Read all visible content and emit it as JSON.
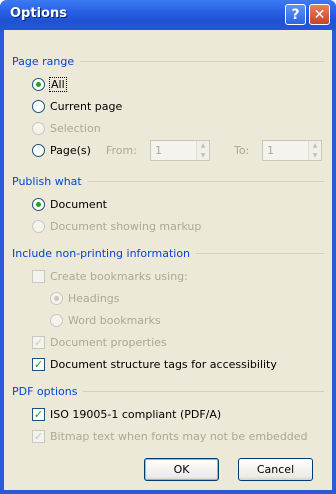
{
  "window": {
    "title": "Options"
  },
  "titlebar": {
    "help_glyph": "?",
    "close_glyph": "✕"
  },
  "page_range": {
    "heading": "Page range",
    "all": "All",
    "current_page": "Current page",
    "selection": "Selection",
    "pages": "Page(s)",
    "from_label": "From:",
    "from_value": "1",
    "to_label": "To:",
    "to_value": "1",
    "selected": "All"
  },
  "publish_what": {
    "heading": "Publish what",
    "document": "Document",
    "document_markup": "Document showing markup",
    "selected": "Document"
  },
  "non_printing": {
    "heading": "Include non-printing information",
    "create_bookmarks": "Create bookmarks using:",
    "headings": "Headings",
    "word_bookmarks": "Word bookmarks",
    "document_properties": "Document properties",
    "structure_tags": "Document structure tags for accessibility"
  },
  "pdf_options": {
    "heading": "PDF options",
    "iso": "ISO 19005-1 compliant (PDF/A)",
    "bitmap_text": "Bitmap text when fonts may not be embedded"
  },
  "buttons": {
    "ok": "OK",
    "cancel": "Cancel"
  },
  "colors": {
    "titlebar": "#2a5bd7",
    "face": "#ece9d8",
    "group_heading": "#0046d5",
    "radio_dot": "#21a121"
  }
}
